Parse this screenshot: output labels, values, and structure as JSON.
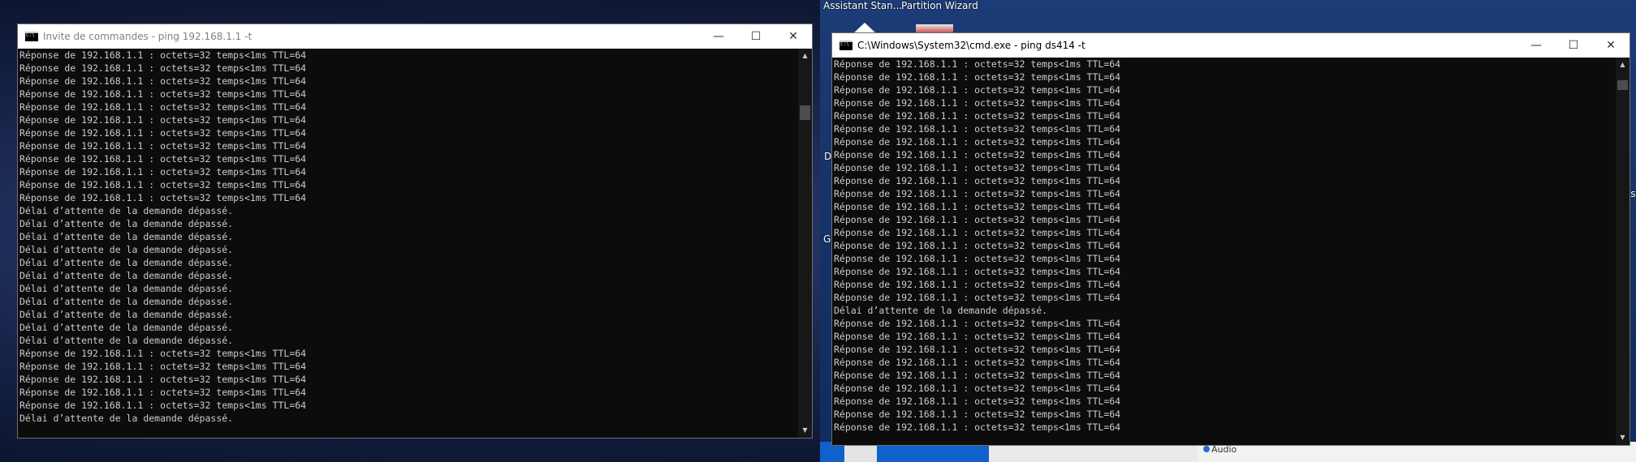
{
  "desktop": {
    "labels": [
      "Assistant Stan...",
      "Partition Wizard"
    ],
    "fragment_left_d": "D",
    "fragment_left_g": "G",
    "fragment_right": "ris",
    "audio_label": "Audio"
  },
  "left_window": {
    "title": "Invite de commandes - ping  192.168.1.1 -t",
    "controls": {
      "minimize": "—",
      "maximize": "☐",
      "close": "✕"
    },
    "lines": [
      "Réponse de 192.168.1.1 : octets=32 temps<1ms TTL=64",
      "Réponse de 192.168.1.1 : octets=32 temps<1ms TTL=64",
      "Réponse de 192.168.1.1 : octets=32 temps<1ms TTL=64",
      "Réponse de 192.168.1.1 : octets=32 temps<1ms TTL=64",
      "Réponse de 192.168.1.1 : octets=32 temps<1ms TTL=64",
      "Réponse de 192.168.1.1 : octets=32 temps<1ms TTL=64",
      "Réponse de 192.168.1.1 : octets=32 temps<1ms TTL=64",
      "Réponse de 192.168.1.1 : octets=32 temps<1ms TTL=64",
      "Réponse de 192.168.1.1 : octets=32 temps<1ms TTL=64",
      "Réponse de 192.168.1.1 : octets=32 temps<1ms TTL=64",
      "Réponse de 192.168.1.1 : octets=32 temps<1ms TTL=64",
      "Réponse de 192.168.1.1 : octets=32 temps<1ms TTL=64",
      "Délai d’attente de la demande dépassé.",
      "Délai d’attente de la demande dépassé.",
      "Délai d’attente de la demande dépassé.",
      "Délai d’attente de la demande dépassé.",
      "Délai d’attente de la demande dépassé.",
      "Délai d’attente de la demande dépassé.",
      "Délai d’attente de la demande dépassé.",
      "Délai d’attente de la demande dépassé.",
      "Délai d’attente de la demande dépassé.",
      "Délai d’attente de la demande dépassé.",
      "Délai d’attente de la demande dépassé.",
      "Réponse de 192.168.1.1 : octets=32 temps<1ms TTL=64",
      "Réponse de 192.168.1.1 : octets=32 temps<1ms TTL=64",
      "Réponse de 192.168.1.1 : octets=32 temps<1ms TTL=64",
      "Réponse de 192.168.1.1 : octets=32 temps<1ms TTL=64",
      "Réponse de 192.168.1.1 : octets=32 temps<1ms TTL=64",
      "Délai d’attente de la demande dépassé."
    ]
  },
  "right_window": {
    "title": "C:\\Windows\\System32\\cmd.exe - ping  ds414 -t",
    "controls": {
      "minimize": "—",
      "maximize": "☐",
      "close": "✕"
    },
    "lines": [
      "Réponse de 192.168.1.1 : octets=32 temps<1ms TTL=64",
      "Réponse de 192.168.1.1 : octets=32 temps<1ms TTL=64",
      "Réponse de 192.168.1.1 : octets=32 temps<1ms TTL=64",
      "Réponse de 192.168.1.1 : octets=32 temps<1ms TTL=64",
      "Réponse de 192.168.1.1 : octets=32 temps<1ms TTL=64",
      "Réponse de 192.168.1.1 : octets=32 temps<1ms TTL=64",
      "Réponse de 192.168.1.1 : octets=32 temps<1ms TTL=64",
      "Réponse de 192.168.1.1 : octets=32 temps<1ms TTL=64",
      "Réponse de 192.168.1.1 : octets=32 temps<1ms TTL=64",
      "Réponse de 192.168.1.1 : octets=32 temps<1ms TTL=64",
      "Réponse de 192.168.1.1 : octets=32 temps<1ms TTL=64",
      "Réponse de 192.168.1.1 : octets=32 temps<1ms TTL=64",
      "Réponse de 192.168.1.1 : octets=32 temps<1ms TTL=64",
      "Réponse de 192.168.1.1 : octets=32 temps<1ms TTL=64",
      "Réponse de 192.168.1.1 : octets=32 temps<1ms TTL=64",
      "Réponse de 192.168.1.1 : octets=32 temps<1ms TTL=64",
      "Réponse de 192.168.1.1 : octets=32 temps<1ms TTL=64",
      "Réponse de 192.168.1.1 : octets=32 temps<1ms TTL=64",
      "Réponse de 192.168.1.1 : octets=32 temps<1ms TTL=64",
      "Délai d’attente de la demande dépassé.",
      "Réponse de 192.168.1.1 : octets=32 temps<1ms TTL=64",
      "Réponse de 192.168.1.1 : octets=32 temps<1ms TTL=64",
      "Réponse de 192.168.1.1 : octets=32 temps<1ms TTL=64",
      "Réponse de 192.168.1.1 : octets=32 temps<1ms TTL=64",
      "Réponse de 192.168.1.1 : octets=32 temps<1ms TTL=64",
      "Réponse de 192.168.1.1 : octets=32 temps<1ms TTL=64",
      "Réponse de 192.168.1.1 : octets=32 temps<1ms TTL=64",
      "Réponse de 192.168.1.1 : octets=32 temps<1ms TTL=64",
      "Réponse de 192.168.1.1 : octets=32 temps<1ms TTL=64"
    ]
  },
  "colors": {
    "console_bg": "#0c0c0c",
    "console_text": "#cccccc",
    "titlebar_bg": "#ffffff"
  }
}
